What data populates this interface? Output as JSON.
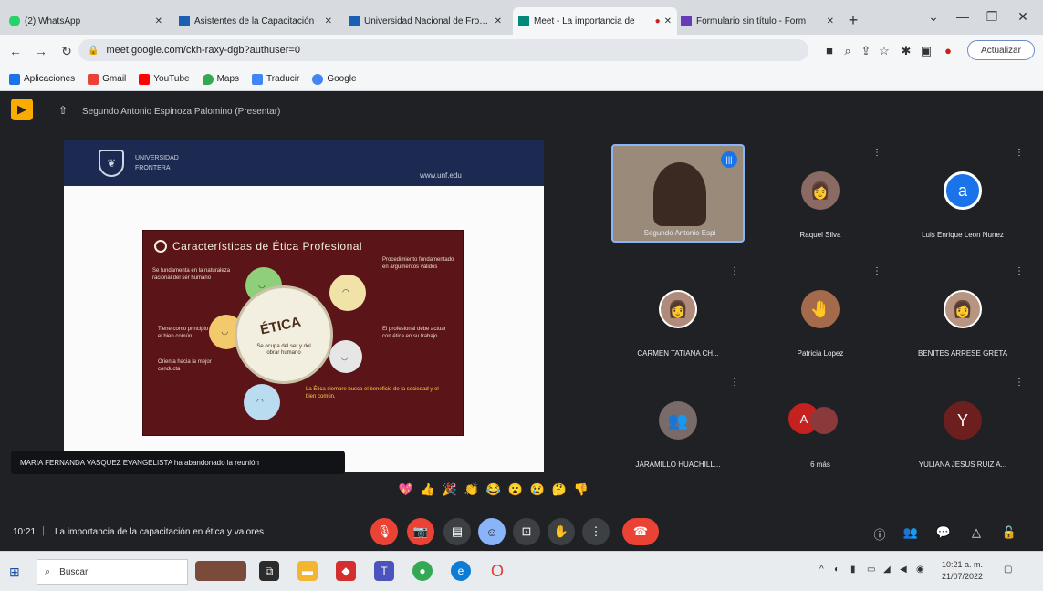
{
  "browser": {
    "tabs": [
      {
        "label": "(2) WhatsApp",
        "favicon_color": "#25d366",
        "active": false
      },
      {
        "label": "Asistentes de la Capacitación",
        "favicon_color": "#1a5fb4",
        "active": false
      },
      {
        "label": "Universidad Nacional de Frontera",
        "favicon_color": "#1a5fb4",
        "active": false
      },
      {
        "label": "Meet - La importancia de",
        "favicon_color": "#00897b",
        "active": true
      },
      {
        "label": "Formulario sin título - Form",
        "favicon_color": "#673ab7",
        "active": false
      }
    ],
    "url": "meet.google.com/ckh-raxy-dgb?authuser=0",
    "update_label": "Actualizar",
    "bookmarks": [
      {
        "label": "Aplicaciones",
        "color": "#1a73e8"
      },
      {
        "label": "Gmail",
        "color": "#ea4335"
      },
      {
        "label": "YouTube",
        "color": "#ff0000"
      },
      {
        "label": "Maps",
        "color": "#34a853"
      },
      {
        "label": "Traducir",
        "color": "#4285f4"
      },
      {
        "label": "Google",
        "color": "#4285f4"
      }
    ]
  },
  "meet": {
    "presenter_text": "Segundo Antonio Espinoza Palomino (Presentar)",
    "slide": {
      "org_line1": "UNIVERSIDAD",
      "org_line2": "FRONTERA",
      "url": "www.unf.edu",
      "card_title": "Características de Ética Profesional",
      "center_word": "ÉTICA",
      "center_sub": "Se ocupa del ser y del obrar humano",
      "left_texts": [
        "Se fundamenta en la naturaleza racional del ser humano",
        "Tiene como principio el bien común",
        "Orienta hacia la mejor conducta"
      ],
      "right_texts": [
        "Procedimiento fundamentado en argumentos válidos",
        "El profesional debe actuar con ética en su trabajo"
      ],
      "highlight": "La Ética siempre busca el beneficio de la sociedad y el bien común."
    },
    "participants": [
      {
        "name": "Segundo Antonio Espi",
        "speaking": true,
        "initial": "",
        "avatar_color": "#7d6b5c"
      },
      {
        "name": "Raquel Silva",
        "speaking": false,
        "initial": "",
        "avatar_color": "#8a6a63"
      },
      {
        "name": "Luis Enrique Leon Nunez",
        "speaking": false,
        "initial": "a",
        "avatar_color": "#1a73e8"
      },
      {
        "name": "CARMEN TATIANA CH...",
        "speaking": false,
        "initial": "",
        "avatar_color": "#b08b7c"
      },
      {
        "name": "Patricia Lopez",
        "speaking": false,
        "initial": "",
        "avatar_color": "#a36a4c"
      },
      {
        "name": "BENITES ARRESE GRETA",
        "speaking": false,
        "initial": "",
        "avatar_color": "#b89580"
      },
      {
        "name": "JARAMILLO HUACHILL...",
        "speaking": false,
        "initial": "",
        "avatar_color": "#7a6b68"
      },
      {
        "name": "6 más",
        "speaking": false,
        "initial": "A",
        "avatar_color": "#c5221f"
      },
      {
        "name": "YULIANA JESUS RUIZ A...",
        "speaking": false,
        "initial": "Y",
        "avatar_color": "#6d1f1f"
      }
    ],
    "toast": "MARIA FERNANDA VASQUEZ EVANGELISTA ha abandonado la reunión",
    "reactions": [
      "💖",
      "👍",
      "🎉",
      "👏",
      "😂",
      "😮",
      "😢",
      "🤔",
      "👎"
    ],
    "time": "10:21",
    "meeting_title": "La importancia de la capacitación en ética y valores",
    "controls": [
      "mic-off",
      "cam-off",
      "captions",
      "emoji",
      "present",
      "raise-hand",
      "more",
      "leave"
    ],
    "right_controls": [
      "info",
      "people",
      "chat",
      "activities",
      "lock"
    ]
  },
  "taskbar": {
    "search_placeholder": "Buscar",
    "clock_time": "10:21 a. m.",
    "clock_date": "21/07/2022",
    "apps": [
      {
        "name": "task-view",
        "color": "#2b2b2b"
      },
      {
        "name": "file-explorer",
        "color": "#f2b632"
      },
      {
        "name": "pdf-reader",
        "color": "#d32f2f"
      },
      {
        "name": "teams",
        "color": "#4b53bc"
      },
      {
        "name": "chrome",
        "color": "#34a853"
      },
      {
        "name": "edge",
        "color": "#0c7cd5"
      },
      {
        "name": "opera",
        "color": "#e53935"
      }
    ]
  }
}
